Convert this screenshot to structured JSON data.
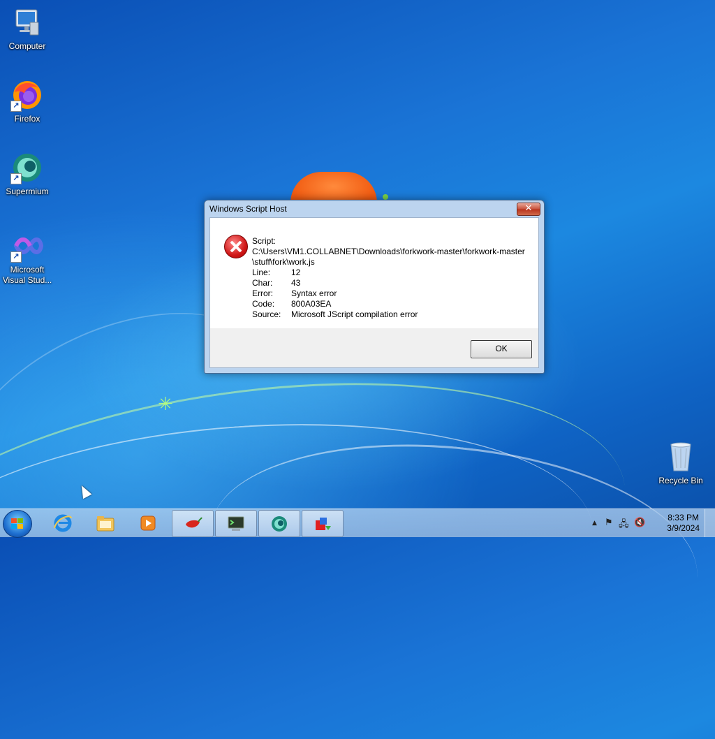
{
  "desktop": {
    "icons": [
      {
        "label": "Computer",
        "icon": "computer-icon"
      },
      {
        "label": "Firefox",
        "icon": "firefox-icon"
      },
      {
        "label": "Supermium",
        "icon": "supermium-icon"
      },
      {
        "label": "Microsoft Visual Stud...",
        "icon": "visual-studio-icon"
      },
      {
        "label": "Recycle Bin",
        "icon": "recycle-bin-icon"
      }
    ]
  },
  "dialog": {
    "title": "Windows Script Host",
    "close_glyph": "✕",
    "script_label": "Script:",
    "script_path": "C:\\Users\\VM1.COLLABNET\\Downloads\\forkwork-master\\forkwork-master\\stuff\\fork\\work.js",
    "fields": [
      {
        "key": "Line:",
        "value": "12"
      },
      {
        "key": "Char:",
        "value": "43"
      },
      {
        "key": "Error:",
        "value": "Syntax error"
      },
      {
        "key": "Code:",
        "value": "800A03EA"
      },
      {
        "key": "Source:",
        "value": "Microsoft JScript compilation error"
      }
    ],
    "ok_label": "OK"
  },
  "taskbar": {
    "pinned": [
      "internet-explorer-icon",
      "file-explorer-icon",
      "media-player-icon"
    ],
    "open": [
      "pepper-app-icon",
      "terminal-app-icon",
      "supermium-icon",
      "script-host-icon"
    ],
    "tray": {
      "chevron": "▲",
      "flag": "⚑",
      "network": "🖧",
      "volume_muted": "🔇"
    },
    "clock": {
      "time": "8:33 PM",
      "date": "3/9/2024"
    }
  }
}
